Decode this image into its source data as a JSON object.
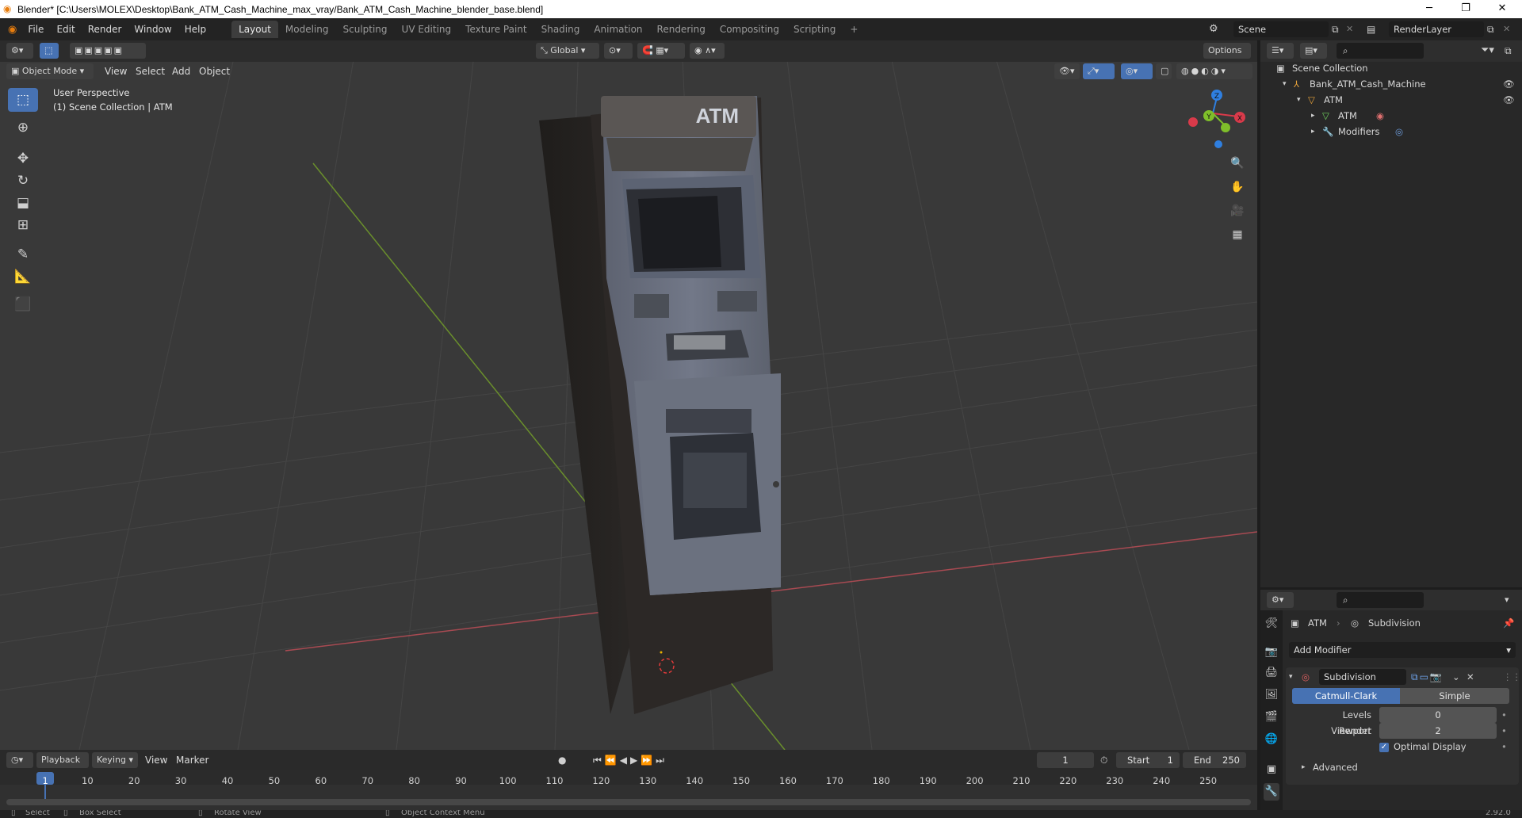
{
  "window": {
    "title": "Blender* [C:\\Users\\MOLEX\\Desktop\\Bank_ATM_Cash_Machine_max_vray/Bank_ATM_Cash_Machine_blender_base.blend]",
    "minimize": "─",
    "maximize": "❐",
    "close": "✕"
  },
  "menus": [
    "File",
    "Edit",
    "Render",
    "Window",
    "Help"
  ],
  "workspaces": [
    "Layout",
    "Modeling",
    "Sculpting",
    "UV Editing",
    "Texture Paint",
    "Shading",
    "Animation",
    "Rendering",
    "Compositing",
    "Scripting",
    "+"
  ],
  "scene": {
    "name": "Scene",
    "render_layer": "RenderLayer"
  },
  "viewport": {
    "mode": "Object Mode",
    "menus": [
      "View",
      "Select",
      "Add",
      "Object"
    ],
    "transform_orientation": "Global",
    "options_label": "Options",
    "info_line1": "User Perspective",
    "info_line2": "(1) Scene Collection | ATM",
    "atm_sign": "ATM",
    "gizmo_labels": {
      "x": "X",
      "y": "Y",
      "z": "Z"
    }
  },
  "outliner": {
    "search_placeholder": "",
    "items": [
      {
        "label": "Scene Collection"
      },
      {
        "label": "Bank_ATM_Cash_Machine"
      },
      {
        "label": "ATM"
      },
      {
        "label": "ATM"
      },
      {
        "label": "Modifiers"
      }
    ]
  },
  "properties": {
    "breadcrumb_object": "ATM",
    "breadcrumb_modifier": "Subdivision",
    "add_modifier": "Add Modifier",
    "modifier_name": "Subdivision",
    "subdiv_type_catmull": "Catmull-Clark",
    "subdiv_type_simple": "Simple",
    "levels_viewport_label": "Levels Viewport",
    "levels_viewport_value": "0",
    "render_label": "Render",
    "render_value": "2",
    "optimal_display_label": "Optimal Display",
    "optimal_display_checked": true,
    "advanced_label": "Advanced"
  },
  "timeline": {
    "menus": [
      "Playback",
      "Keying",
      "View",
      "Marker"
    ],
    "current_frame": "1",
    "start_label": "Start",
    "start_value": "1",
    "end_label": "End",
    "end_value": "250",
    "ruler": [
      "1",
      "10",
      "20",
      "30",
      "40",
      "50",
      "60",
      "70",
      "80",
      "90",
      "100",
      "110",
      "120",
      "130",
      "140",
      "150",
      "160",
      "170",
      "180",
      "190",
      "200",
      "210",
      "220",
      "230",
      "240",
      "250"
    ]
  },
  "statusbar": {
    "select": "Select",
    "box_select": "Box Select",
    "rotate_view": "Rotate View",
    "context_menu": "Object Context Menu",
    "version": "2.92.0"
  },
  "colors": {
    "accent": "#4772b3",
    "x_axis": "#d93a4a",
    "y_axis": "#7fbf2a",
    "z_axis": "#2f7fe0"
  }
}
